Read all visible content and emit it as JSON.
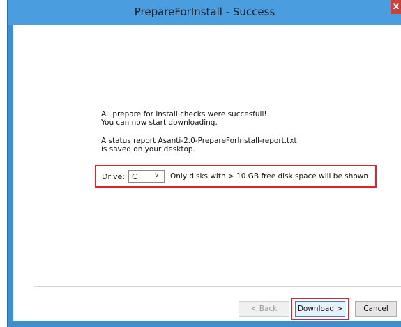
{
  "window": {
    "title": "PrepareForInstall - Success",
    "close_glyph": "x"
  },
  "messages": {
    "line1": "All prepare for install checks were succesfull!",
    "line2": "You can now start downloading.",
    "line3": "A status report Asanti-2.0-PrepareForInstall-report.txt",
    "line4": "is saved on your desktop."
  },
  "drive": {
    "label": "Drive:",
    "selected": "C",
    "dropdown_arrow": "∨",
    "note": "Only disks with > 10 GB free disk space will be shown"
  },
  "buttons": {
    "back": "< Back",
    "download": "Download >",
    "cancel": "Cancel"
  },
  "colors": {
    "titlebar": "#4a9ee0",
    "frame": "#3f8fd0",
    "highlight": "#d9262c",
    "close": "#c7423a"
  }
}
